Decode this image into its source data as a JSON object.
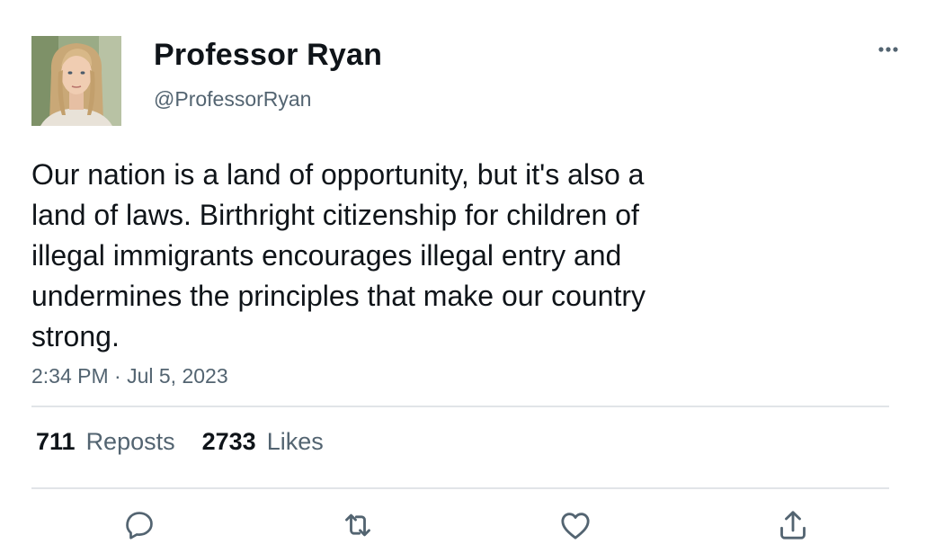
{
  "author": {
    "display_name": "Professor Ryan",
    "handle": "@ProfessorRyan",
    "avatar": "profile-photo-woman"
  },
  "tweet": {
    "text": "Our nation is a land of opportunity, but it's also a\nland of laws. Birthright citizenship for children of\nillegal immigrants encourages illegal entry and\nundermines the principles that make our country\nstrong.",
    "timestamp": "2:34 PM · Jul 5, 2023"
  },
  "stats": {
    "reposts_count": "711",
    "reposts_label": "Reposts",
    "likes_count": "2733",
    "likes_label": "Likes"
  },
  "icons": {
    "more": "more-horizontal-icon",
    "reply": "reply-icon",
    "repost": "repost-icon",
    "like": "heart-icon",
    "share": "share-icon"
  },
  "colors": {
    "text_primary": "#0f1419",
    "text_secondary": "#536471",
    "divider": "#e1e4e8",
    "icon": "#536471"
  }
}
